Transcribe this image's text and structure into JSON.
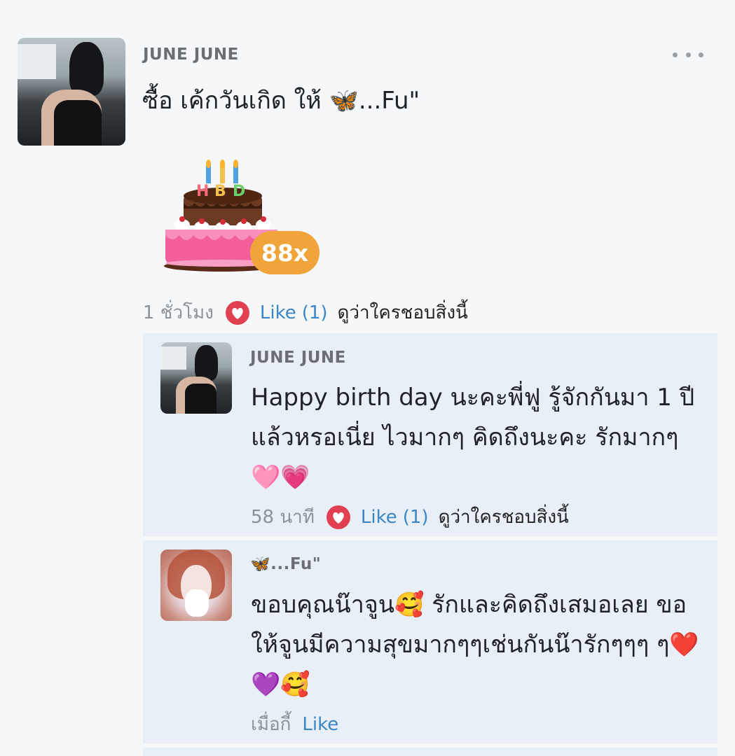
{
  "post": {
    "author": "JUNE JUNE",
    "text": "ซื้อ เค้กวันเกิด ให้ 🦋...Fu\"",
    "sticker": {
      "name": "birthday-cake-sticker",
      "cake_letters": "HBD",
      "badge": "88x"
    },
    "time": "1 ชั่วโมง",
    "like_label": "Like",
    "like_count": "(1)",
    "who_likes": "ดูว่าใครชอบสิ่งนี้"
  },
  "comments": [
    {
      "author": "JUNE JUNE",
      "text": "Happy birth day นะคะพี่ฟู รู้จักกันมา 1 ปี แล้วหรอเนี่ย ไวมากๆ คิดถึงนะคะ รักมากๆ 🩷💗",
      "time": "58 นาที",
      "like_label": "Like",
      "like_count": "(1)",
      "who_likes": "ดูว่าใครชอบสิ่งนี้"
    },
    {
      "author": "🦋...Fu\"",
      "text": "ขอบคุณน๊าจูน🥰 รักและคิดถึงเสมอเลย ขอให้จูนมีความสุขมากๆๆเช่นกันน๊ารักๆๆๆ ๆ❤️💜🥰",
      "time": "เมื่อกี้",
      "like_label": "Like"
    }
  ],
  "colors": {
    "background": "#f6f7f9",
    "comment_bg": "#e8eff7",
    "link_blue": "#3b86c4",
    "like_red": "#e0404f",
    "badge_orange": "#f0a43a",
    "muted_gray": "#8c9196"
  }
}
